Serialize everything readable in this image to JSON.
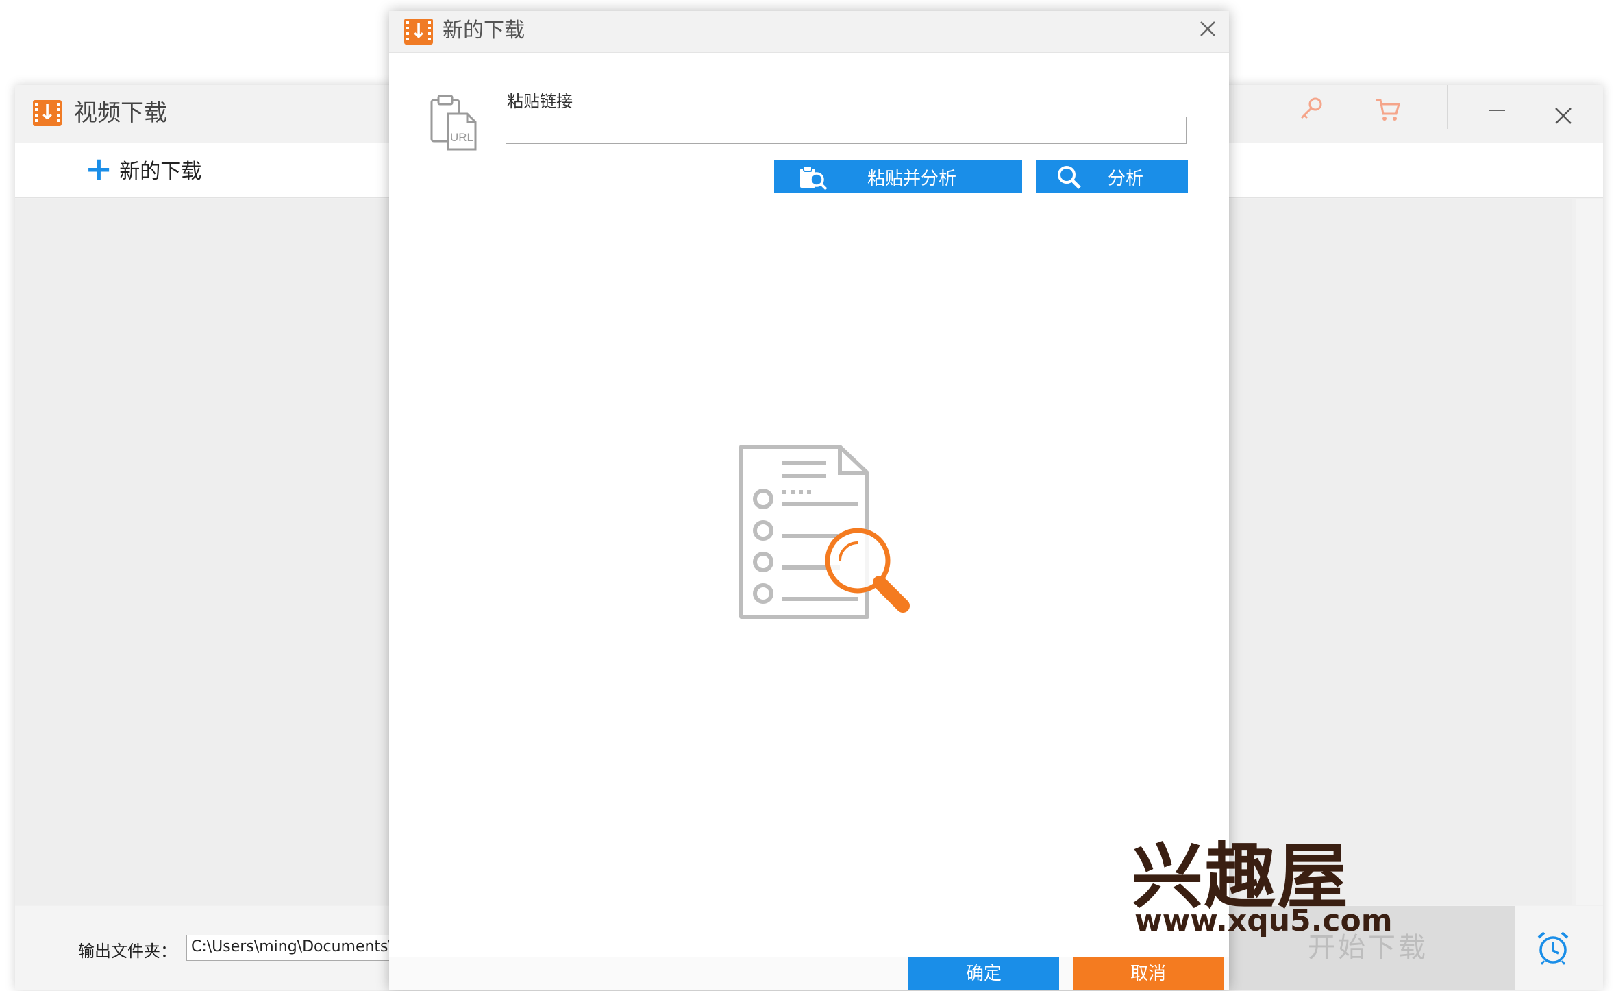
{
  "main": {
    "title": "视频下载",
    "toolbar": {
      "new_download_label": "新的下载"
    },
    "bottom": {
      "output_folder_label": "输出文件夹：",
      "output_folder_value": "C:\\Users\\ming\\Documents\\Wo",
      "start_download_label": "开始下载"
    },
    "icons": [
      "app-logo-icon",
      "key-icon",
      "cart-icon",
      "minimize-icon",
      "close-icon",
      "alarm-clock-icon",
      "plus-icon"
    ],
    "colors": {
      "accent_blue": "#1a8ee8",
      "accent_orange": "#f47b20"
    }
  },
  "dialog": {
    "title": "新的下载",
    "paste_link_label": "粘贴链接",
    "url_input_value": "",
    "url_icon_text": "URL",
    "paste_and_analyze_label": "粘贴并分析",
    "analyze_label": "分析",
    "ok_label": "确定",
    "cancel_label": "取消"
  },
  "watermark": {
    "logo_text": "兴趣屋",
    "url": "www.xqu5.com"
  }
}
